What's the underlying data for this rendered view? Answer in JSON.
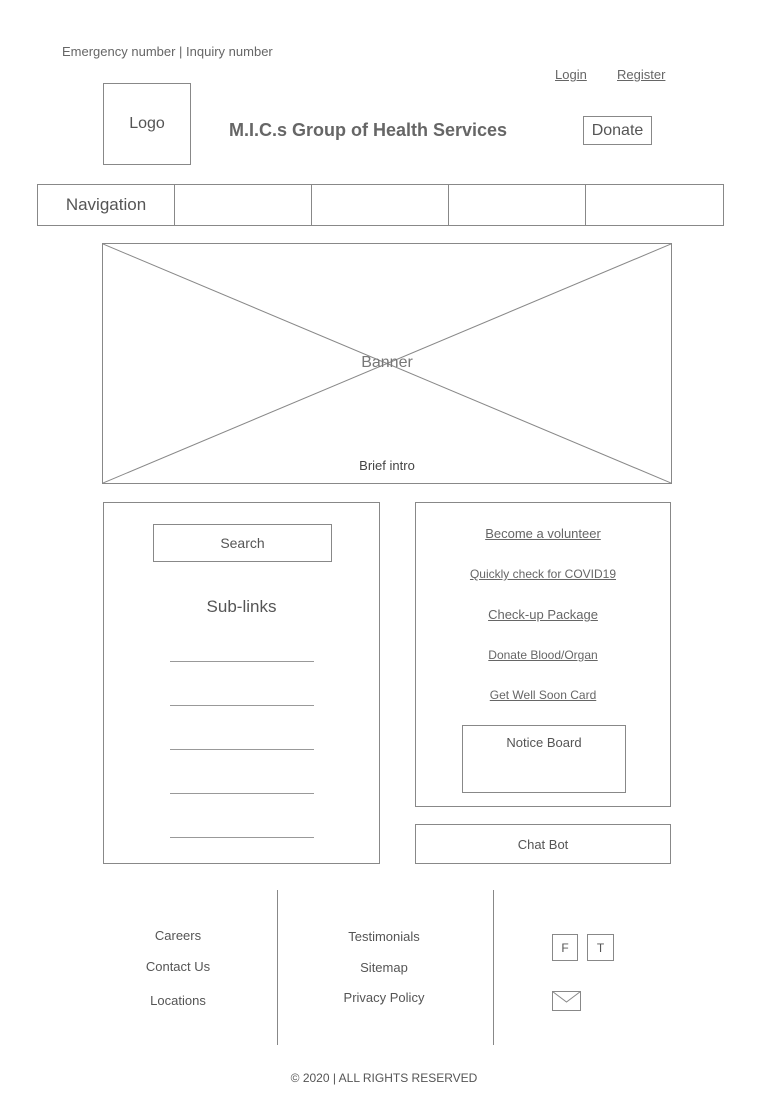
{
  "header": {
    "contact_line": "Emergency number | Inquiry number",
    "login": "Login",
    "register": "Register",
    "logo": "Logo",
    "title": "M.I.C.s Group of Health Services",
    "donate": "Donate"
  },
  "nav": {
    "label": "Navigation",
    "items": [
      "",
      "",
      "",
      ""
    ]
  },
  "banner": {
    "label": "Banner",
    "intro": "Brief intro"
  },
  "left_panel": {
    "search": "Search",
    "sublinks_title": "Sub-links"
  },
  "right_panel": {
    "links": [
      "Become a volunteer",
      "Quickly check for COVID19",
      "Check-up Package",
      "Donate Blood/Organ",
      "Get Well Soon Card"
    ],
    "notice_board": "Notice Board"
  },
  "chat_bot": "Chat Bot",
  "footer": {
    "col1": [
      "Careers",
      "Contact Us",
      "Locations"
    ],
    "col2": [
      "Testimonials",
      "Sitemap",
      "Privacy Policy"
    ],
    "social": {
      "facebook": "F",
      "twitter": "T"
    },
    "copyright": "© 2020 | ALL RIGHTS RESERVED"
  },
  "colors": {
    "border": "#888888",
    "text": "#555555",
    "background": "#ffffff"
  }
}
